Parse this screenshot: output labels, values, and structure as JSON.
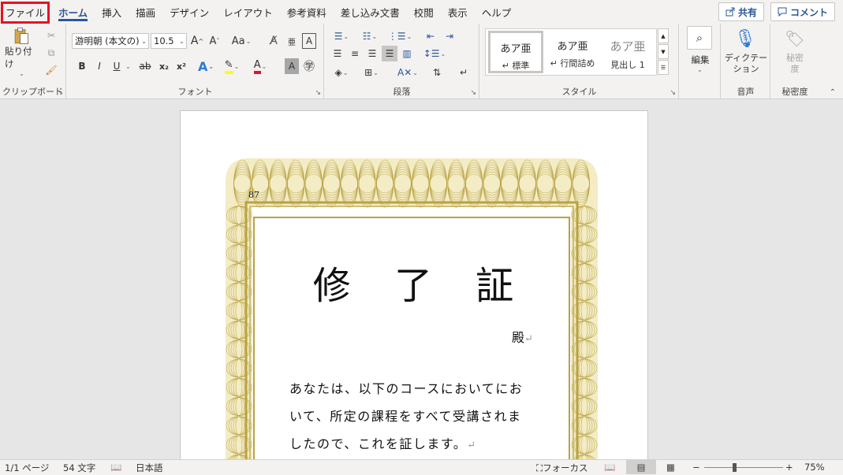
{
  "menu": {
    "file": "ファイル",
    "tabs": [
      "ホーム",
      "挿入",
      "描画",
      "デザイン",
      "レイアウト",
      "参考資料",
      "差し込み文書",
      "校閲",
      "表示",
      "ヘルプ"
    ],
    "share": "共有",
    "comment": "コメント"
  },
  "ribbon": {
    "clipboard": {
      "paste": "貼り付け",
      "label": "クリップボード"
    },
    "font": {
      "name": "游明朝 (本文の)",
      "size": "10.5",
      "label": "フォント",
      "aa": "Aa",
      "bold": "B",
      "italic": "I",
      "underline": "U",
      "strike": "ab",
      "sub": "x₂",
      "sup": "x²"
    },
    "paragraph": {
      "label": "段落"
    },
    "styles": {
      "label": "スタイル",
      "items": [
        {
          "sample": "あア亜",
          "name": "↵ 標準"
        },
        {
          "sample": "あア亜",
          "name": "↵ 行間詰め"
        },
        {
          "sample": "あア亜",
          "name": "見出し 1"
        }
      ]
    },
    "edit": {
      "label": "編集"
    },
    "voice": {
      "dictate": "ディクテー\nション",
      "label": "音声"
    },
    "sensitivity": {
      "btn": "秘密\n度",
      "label": "秘密度"
    }
  },
  "document": {
    "corner_number": "87",
    "title": "修 了 証",
    "dono": "殿",
    "body_lines": [
      "あなたは、以下のコースにおいてにお",
      "いて、所定の課程をすべて受講されま",
      "したので、これを証します。"
    ],
    "frame_color": "#b9a243"
  },
  "status": {
    "page": "1/1 ページ",
    "words": "54 文字",
    "language": "日本語",
    "focus": "フォーカス",
    "zoom_minus": "−",
    "zoom_plus": "+",
    "zoom": "75%",
    "zoom_fraction": 0.38
  }
}
